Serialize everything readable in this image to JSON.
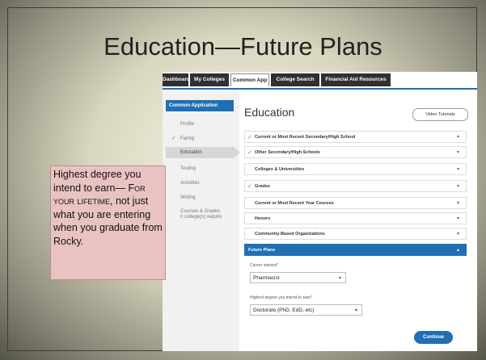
{
  "slide": {
    "title": "Education—Future Plans"
  },
  "callout": {
    "line1": "Highest degree you intend to earn—",
    "emphasis": "For your lifetime,",
    "line2": "not just what you are entering when you graduate from Rocky."
  },
  "nav": {
    "tabs": [
      {
        "label": "Dashboard"
      },
      {
        "label": "My Colleges"
      },
      {
        "label": "Common App"
      },
      {
        "label": "College Search"
      },
      {
        "label": "Financial Aid Resources"
      }
    ],
    "active_index": 2
  },
  "sidebar": {
    "header": "Common Application",
    "items": [
      {
        "label": "Profile",
        "checked": false
      },
      {
        "label": "Family",
        "checked": true
      },
      {
        "label": "Education",
        "checked": false,
        "active": true
      },
      {
        "label": "Testing",
        "checked": false
      },
      {
        "label": "Activities",
        "checked": false
      },
      {
        "label": "Writing",
        "checked": false
      },
      {
        "label": "Courses & Grades",
        "sublabel": "0 college(s) require",
        "checked": false
      }
    ]
  },
  "main": {
    "title": "Education",
    "video_button": "Video Tutorials",
    "sections": [
      {
        "label": "Current or Most Recent Secondary/High School",
        "checked": true
      },
      {
        "label": "Other Secondary/High Schools",
        "checked": true
      },
      {
        "label": "Colleges & Universities",
        "checked": false
      },
      {
        "label": "Grades",
        "checked": true
      },
      {
        "label": "Current or Most Recent Year Courses",
        "checked": false
      },
      {
        "label": "Honors",
        "checked": false
      },
      {
        "label": "Community-Based Organizations",
        "checked": false
      },
      {
        "label": "Future Plans",
        "checked": false,
        "open": true
      }
    ],
    "future_plans": {
      "career_label": "Career interest*",
      "career_value": "Pharmacist",
      "degree_label": "Highest degree you intend to earn*",
      "degree_value": "Doctorate (PhD, EdD, etc)",
      "continue_label": "Continue"
    }
  },
  "colors": {
    "accent": "#1f6fb4",
    "check": "#3aa04a",
    "callout_bg": "#e9c3c2"
  }
}
